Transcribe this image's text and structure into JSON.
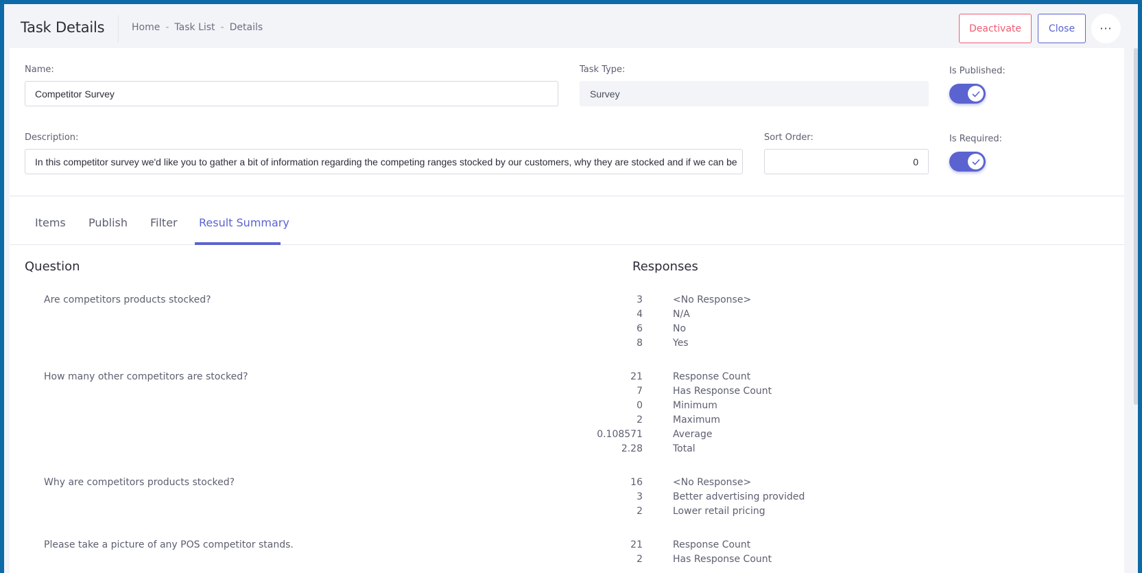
{
  "header": {
    "title": "Task Details",
    "breadcrumb": [
      "Home",
      "-",
      "Task List",
      "-",
      "Details"
    ],
    "deactivate_label": "Deactivate",
    "close_label": "Close",
    "more_label": "···"
  },
  "form": {
    "name_label": "Name:",
    "name_value": "Competitor Survey",
    "task_type_label": "Task Type:",
    "task_type_value": "Survey",
    "is_published_label": "Is Published:",
    "is_published": true,
    "description_label": "Description:",
    "description_value": "In this competitor survey we'd like you to gather a bit of information regarding the competing ranges stocked by our customers, why they are stocked and if we can be",
    "sort_order_label": "Sort Order:",
    "sort_order_value": "0",
    "is_required_label": "Is Required:",
    "is_required": true
  },
  "tabs": [
    {
      "label": "Items",
      "active": false
    },
    {
      "label": "Publish",
      "active": false
    },
    {
      "label": "Filter",
      "active": false
    },
    {
      "label": "Result Summary",
      "active": true
    }
  ],
  "summary": {
    "question_header": "Question",
    "responses_header": "Responses",
    "questions": [
      {
        "text": "Are competitors products stocked?",
        "responses": [
          {
            "value": "3",
            "label": "<No Response>"
          },
          {
            "value": "4",
            "label": "N/A"
          },
          {
            "value": "6",
            "label": "No"
          },
          {
            "value": "8",
            "label": "Yes"
          }
        ]
      },
      {
        "text": "How many other competitors are stocked?",
        "responses": [
          {
            "value": "21",
            "label": "Response Count"
          },
          {
            "value": "7",
            "label": "Has Response Count"
          },
          {
            "value": "0",
            "label": "Minimum"
          },
          {
            "value": "2",
            "label": "Maximum"
          },
          {
            "value": "0.108571",
            "label": "Average"
          },
          {
            "value": "2.28",
            "label": "Total"
          }
        ]
      },
      {
        "text": "Why are competitors products stocked?",
        "responses": [
          {
            "value": "16",
            "label": "<No Response>"
          },
          {
            "value": "3",
            "label": "Better advertising provided"
          },
          {
            "value": "2",
            "label": "Lower retail pricing"
          }
        ]
      },
      {
        "text": "Please take a picture of any POS competitor stands.",
        "responses": [
          {
            "value": "21",
            "label": "Response Count"
          },
          {
            "value": "2",
            "label": "Has Response Count"
          }
        ]
      }
    ]
  },
  "colors": {
    "accent": "#5b63d0",
    "danger": "#ef5b73",
    "frame": "#0d6aa6"
  }
}
